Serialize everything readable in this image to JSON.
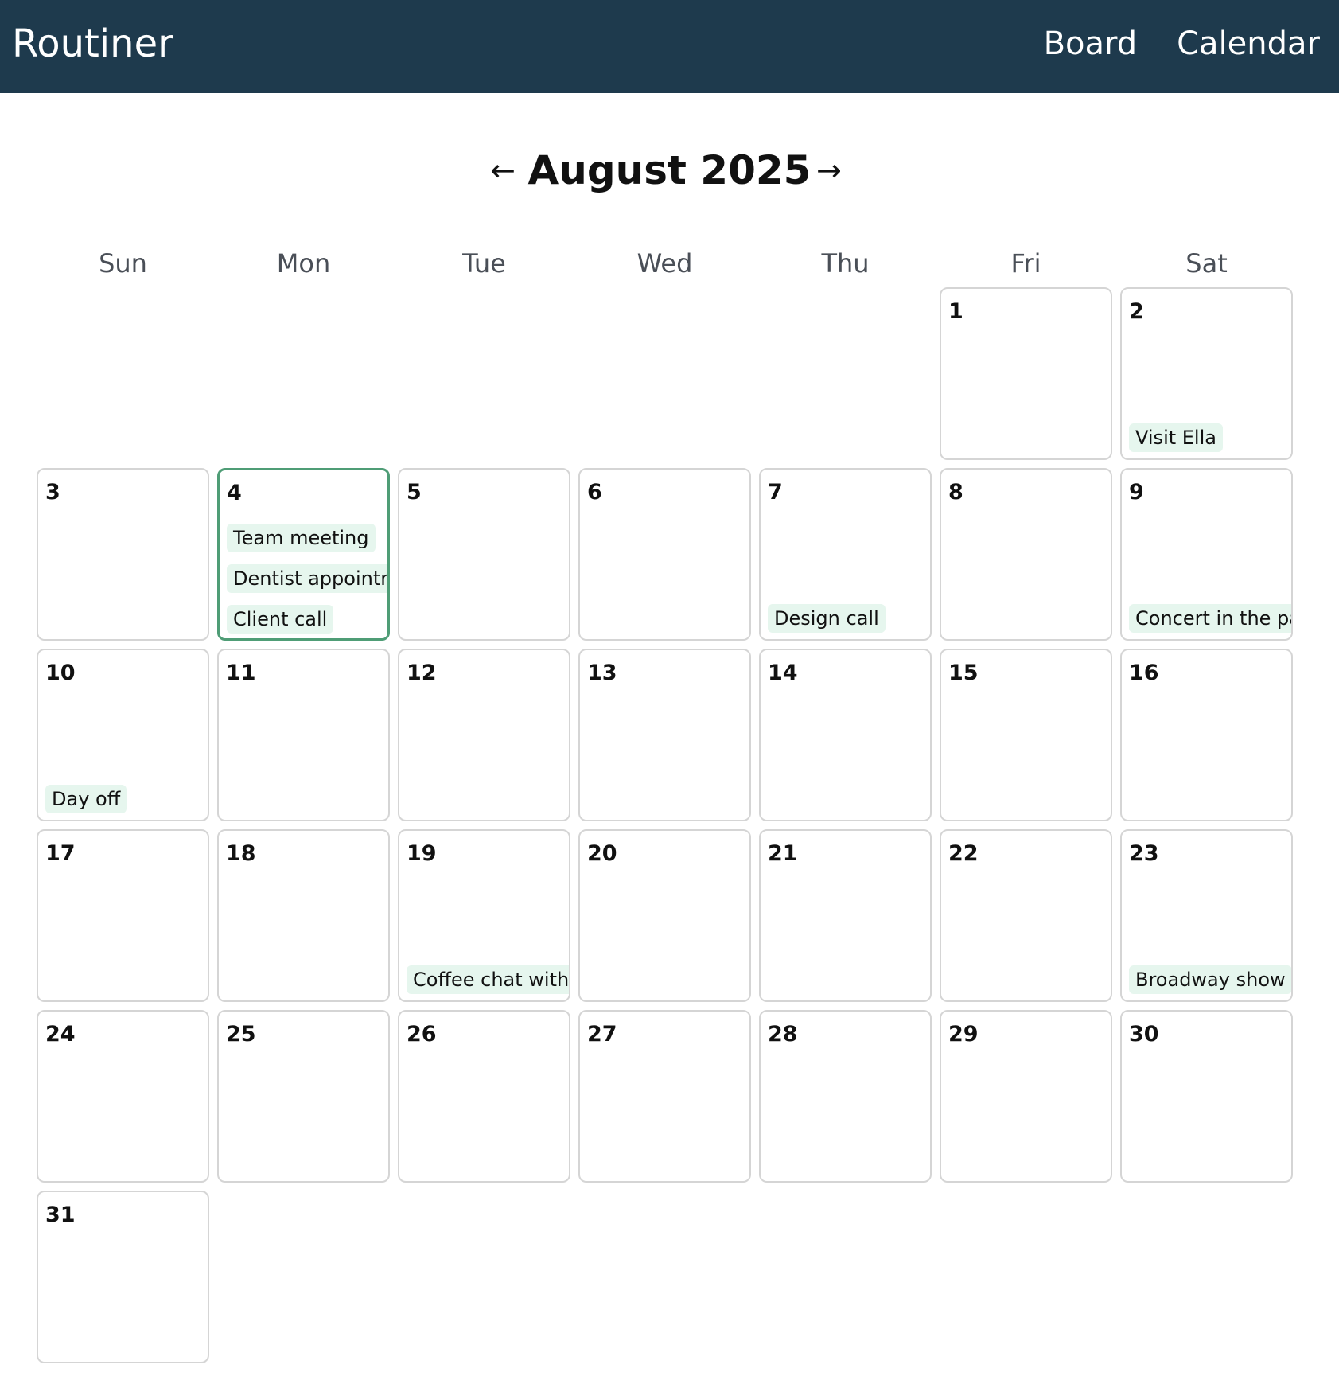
{
  "app": {
    "title": "Routiner",
    "nav": [
      {
        "label": "Board"
      },
      {
        "label": "Calendar"
      }
    ]
  },
  "calendar": {
    "month_label": "August 2025",
    "prev_label": "←",
    "next_label": "→",
    "weekdays": [
      "Sun",
      "Mon",
      "Tue",
      "Wed",
      "Thu",
      "Fri",
      "Sat"
    ],
    "first_weekday_index": 5,
    "today": 4,
    "days": [
      {
        "day": "1",
        "events": []
      },
      {
        "day": "2",
        "events": [
          "Visit Ella"
        ]
      },
      {
        "day": "3",
        "events": []
      },
      {
        "day": "4",
        "events": [
          "Team meeting",
          "Dentist appointment",
          "Client call"
        ]
      },
      {
        "day": "5",
        "events": []
      },
      {
        "day": "6",
        "events": []
      },
      {
        "day": "7",
        "events": [
          "Design call"
        ]
      },
      {
        "day": "8",
        "events": []
      },
      {
        "day": "9",
        "events": [
          "Concert in the park"
        ]
      },
      {
        "day": "10",
        "events": [
          "Day off"
        ]
      },
      {
        "day": "11",
        "events": []
      },
      {
        "day": "12",
        "events": []
      },
      {
        "day": "13",
        "events": []
      },
      {
        "day": "14",
        "events": []
      },
      {
        "day": "15",
        "events": []
      },
      {
        "day": "16",
        "events": []
      },
      {
        "day": "17",
        "events": []
      },
      {
        "day": "18",
        "events": []
      },
      {
        "day": "19",
        "events": [
          "Coffee chat with Ja"
        ]
      },
      {
        "day": "20",
        "events": []
      },
      {
        "day": "21",
        "events": []
      },
      {
        "day": "22",
        "events": []
      },
      {
        "day": "23",
        "events": [
          "Broadway show"
        ]
      },
      {
        "day": "24",
        "events": []
      },
      {
        "day": "25",
        "events": []
      },
      {
        "day": "26",
        "events": []
      },
      {
        "day": "27",
        "events": []
      },
      {
        "day": "28",
        "events": []
      },
      {
        "day": "29",
        "events": []
      },
      {
        "day": "30",
        "events": []
      },
      {
        "day": "31",
        "events": []
      }
    ]
  }
}
